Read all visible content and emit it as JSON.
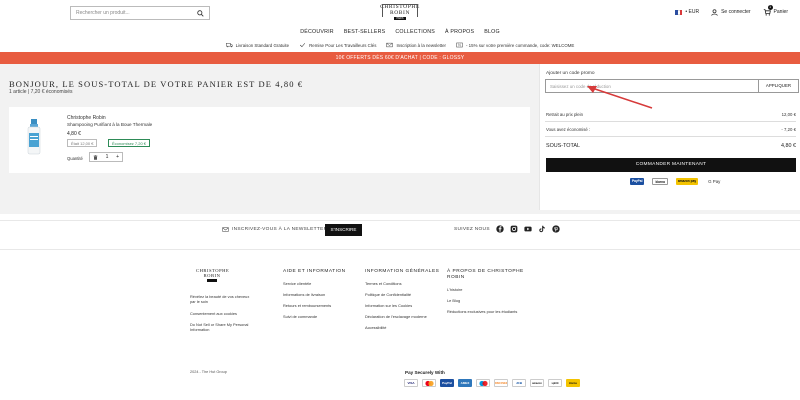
{
  "header": {
    "search_placeholder": "Rechercher un produit...",
    "logo_line1": "CHRISTOPHE",
    "logo_line2": "ROBIN",
    "logo_bar": "PARIS",
    "currency": "• EUR",
    "account": "Se connecter",
    "cart": "Panier",
    "cart_count": "1"
  },
  "nav": [
    "DÉCOUVRIR",
    "BEST-SELLERS",
    "COLLECTIONS",
    "À PROPOS",
    "BLOG"
  ],
  "usp": [
    {
      "icon": "truck-icon",
      "text": "Livraison Standard Gratuite"
    },
    {
      "icon": "check-icon",
      "text": "Remise Pour Les Travailleurs Clés"
    },
    {
      "icon": "mail-icon",
      "text": "Inscription à la newsletter"
    },
    {
      "icon": "percent-icon",
      "text": "- 15% sur votre première commande, code: WELCOME"
    }
  ],
  "promo_banner": "10€ OFFERTS DÈS 60€ D'ACHAT | CODE : GLOSSY",
  "cart": {
    "greeting": "BONJOUR, LE SOUS-TOTAL DE VOTRE PANIER EST DE 4,80 €",
    "count_text": "1 article | 7,20 € économisés",
    "item": {
      "brand": "Christophe Robin",
      "name": "Shampooing Purifiant à la Boue Thermale",
      "price": "4,80 €",
      "was": "Était 12,00 €",
      "saved": "Économisez 7,20 €",
      "qty_label": "Quantité",
      "qty": "1",
      "minus": "-",
      "plus": "+"
    }
  },
  "summary": {
    "coupon_label": "Ajouter un code promo",
    "coupon_placeholder": "Saisissez un code de réduction",
    "apply": "APPLIQUER",
    "rows": [
      {
        "label": "Retrait au prix plein",
        "value": "12,00 €"
      },
      {
        "label": "Vous avez économisé :",
        "value": "- 7,20 €"
      }
    ],
    "subtotal_label": "SOUS-TOTAL",
    "subtotal_value": "4,80 €",
    "checkout": "COMMANDER MAINTENANT",
    "pay_badges": [
      "PayPal",
      "klarna",
      "amazon pay",
      "G Pay"
    ]
  },
  "newsletter": {
    "text": "INSCRIVEZ-VOUS À LA NEWSLETTER",
    "button": "S'INSCRIRE",
    "follow": "SUIVEZ NOUS"
  },
  "socials": [
    "facebook-icon",
    "instagram-icon",
    "youtube-icon",
    "tiktok-icon",
    "pinterest-icon"
  ],
  "footer": {
    "logo_line1": "CHRISTOPHE",
    "logo_line2": "ROBIN",
    "col0": [
      "Révélez la beauté de vos cheveux",
      "par le soin",
      "Consentement aux cookies",
      "Do Not Sell or Share My Personal",
      "Information"
    ],
    "col1_head": "AIDE ET INFORMATION",
    "col1": [
      "Service clientèle",
      "Informations de livraison",
      "Retours et remboursements",
      "Suivi de commande"
    ],
    "col2_head": "INFORMATION GÉNÉRALES",
    "col2": [
      "Termes et Conditions",
      "Politique de Confidentialité",
      "Information sur les Cookies",
      "Déclaration de l'esclavage moderne",
      "Accessibilité"
    ],
    "col3_head1": "À PROPOS DE CHRISTOPHE",
    "col3_head2": "ROBIN",
    "col3": [
      "L'histoire",
      "Le Blog",
      "Réductions exclusives pour les étudiants"
    ],
    "copyright": "2024 - The Hut Group",
    "pay_secure": "Pay Securely With",
    "payments": [
      "VISA",
      "MC",
      "PayPal",
      "AMEX",
      "Maestro",
      "DISCOVER",
      "JCB",
      "amazon",
      "splitit",
      "klarna"
    ]
  }
}
